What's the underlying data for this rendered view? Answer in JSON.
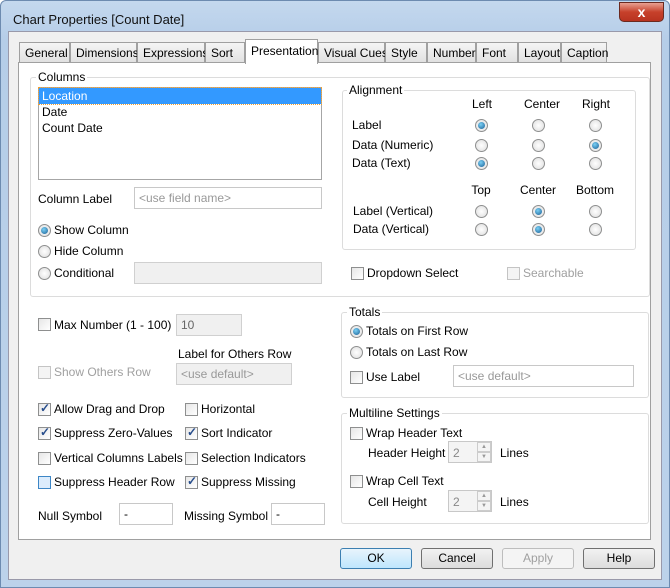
{
  "window": {
    "title": "Chart Properties [Count Date]",
    "close": "x"
  },
  "tabs": [
    "General",
    "Dimensions",
    "Expressions",
    "Sort",
    "Presentation",
    "Visual Cues",
    "Style",
    "Number",
    "Font",
    "Layout",
    "Caption"
  ],
  "columns": {
    "group": "Columns",
    "items": [
      "Location",
      "Date",
      "Count Date"
    ],
    "column_label": "Column Label",
    "column_label_placeholder": "<use field name>",
    "show_column": {
      "label": "Show Column",
      "checked": true
    },
    "hide_column": {
      "label": "Hide Column",
      "checked": false
    },
    "conditional": {
      "label": "Conditional",
      "checked": false
    }
  },
  "alignment": {
    "group": "Alignment",
    "h_headers": [
      "Left",
      "Center",
      "Right"
    ],
    "v_headers": [
      "Top",
      "Center",
      "Bottom"
    ],
    "rows": [
      {
        "label": "Label",
        "selected": 0
      },
      {
        "label": "Data (Numeric)",
        "selected": 2
      },
      {
        "label": "Data (Text)",
        "selected": 0
      }
    ],
    "vrows": [
      {
        "label": "Label (Vertical)",
        "selected": 1
      },
      {
        "label": "Data (Vertical)",
        "selected": 1
      }
    ]
  },
  "dropdown_select": {
    "label": "Dropdown Select",
    "checked": false
  },
  "searchable": {
    "label": "Searchable",
    "checked": false
  },
  "max_number": {
    "label": "Max Number (1 - 100)",
    "checked": false,
    "value": "10"
  },
  "others": {
    "label": "Label for Others Row",
    "placeholder": "<use default>",
    "show_label": "Show Others Row",
    "checked": false
  },
  "options": [
    {
      "label": "Allow Drag and Drop",
      "checked": true
    },
    {
      "label": "Horizontal",
      "checked": false
    },
    {
      "label": "Suppress Zero-Values",
      "checked": true
    },
    {
      "label": "Sort Indicator",
      "checked": true
    },
    {
      "label": "Vertical Columns Labels",
      "checked": false
    },
    {
      "label": "Selection Indicators",
      "checked": false
    },
    {
      "label": "Suppress Header Row",
      "checked": false
    },
    {
      "label": "Suppress Missing",
      "checked": true
    }
  ],
  "null_symbol": {
    "label": "Null Symbol",
    "value": "-"
  },
  "missing_symbol": {
    "label": "Missing Symbol",
    "value": "-"
  },
  "totals": {
    "group": "Totals",
    "first": {
      "label": "Totals on First Row",
      "checked": true
    },
    "last": {
      "label": "Totals on Last Row",
      "checked": false
    },
    "use_label": {
      "label": "Use Label",
      "checked": false
    },
    "placeholder": "<use default>"
  },
  "multiline": {
    "group": "Multiline Settings",
    "wrap_header": {
      "label": "Wrap Header Text",
      "checked": false
    },
    "header_height": "Header Height",
    "header_value": "2",
    "wrap_cell": {
      "label": "Wrap Cell Text",
      "checked": false
    },
    "cell_height": "Cell Height",
    "cell_value": "2",
    "lines": "Lines"
  },
  "buttons": {
    "ok": "OK",
    "cancel": "Cancel",
    "apply": "Apply",
    "help": "Help"
  }
}
